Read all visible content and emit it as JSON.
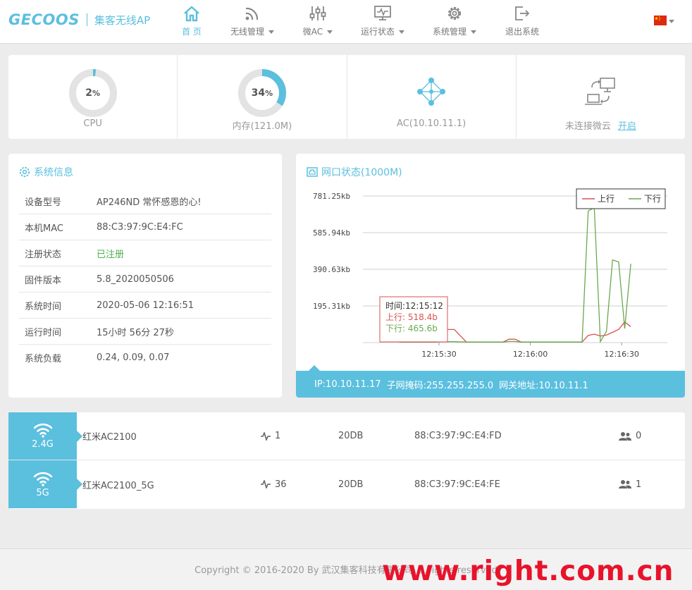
{
  "brand": {
    "logo": "GECOOS",
    "subtitle": "集客无线AP"
  },
  "nav": [
    {
      "label": "首 页",
      "icon": "home-icon",
      "active": true
    },
    {
      "label": "无线管理",
      "icon": "wifi-signal-icon",
      "dropdown": true
    },
    {
      "label": "微AC",
      "icon": "sliders-icon",
      "dropdown": true
    },
    {
      "label": "运行状态",
      "icon": "monitor-icon",
      "dropdown": true
    },
    {
      "label": "系统管理",
      "icon": "gear-icon",
      "dropdown": true
    },
    {
      "label": "退出系统",
      "icon": "logout-icon"
    }
  ],
  "language_flag": "china-flag-icon",
  "stats": {
    "cpu": {
      "value": "2",
      "unit": "%",
      "label": "CPU",
      "fraction": 0.02
    },
    "memory": {
      "value": "34",
      "unit": "%",
      "label": "内存(121.0M)",
      "fraction": 0.34
    },
    "ac": {
      "label": "AC(10.10.11.1)",
      "icon": "network-topology-icon"
    },
    "cloud": {
      "label": "未连接微云",
      "link": "开启",
      "icon": "remote-connection-icon"
    }
  },
  "system_info": {
    "title": "系统信息",
    "rows": [
      {
        "key": "设备型号",
        "value": "AP246ND 常怀感恩的心!"
      },
      {
        "key": "本机MAC",
        "value": "88:C3:97:9C:E4:FC"
      },
      {
        "key": "注册状态",
        "value": "已注册",
        "status": "success"
      },
      {
        "key": "固件版本",
        "value": "5.8_2020050506"
      },
      {
        "key": "系统时间",
        "value": "2020-05-06 12:16:51"
      },
      {
        "key": "运行时间",
        "value": "15小时 56分 27秒"
      },
      {
        "key": "系统负载",
        "value": "0.24, 0.09, 0.07"
      }
    ]
  },
  "network": {
    "title": "网口状态(1000M)",
    "ip": "IP:10.10.11.17",
    "mask": "子网掩码:255.255.255.0",
    "gateway": "网关地址:10.10.11.1"
  },
  "chart_data": {
    "type": "line",
    "title": "",
    "x_ticks": [
      "12:15:30",
      "12:16:00",
      "12:16:30"
    ],
    "y_ticks": [
      "195.31kb",
      "390.63kb",
      "585.94kb",
      "781.25kb"
    ],
    "ylim": [
      0,
      781.25
    ],
    "y_unit": "kb",
    "grid": true,
    "legend_position": "top-right",
    "series": [
      {
        "name": "上行",
        "color": "#d9534f",
        "x": [
          12,
          18,
          24,
          26,
          28,
          30,
          34,
          38,
          42,
          46,
          48,
          50,
          52,
          54,
          56,
          58,
          60,
          62,
          64,
          66,
          68,
          70,
          72,
          74,
          76,
          78,
          80,
          82,
          84,
          86,
          88
        ],
        "y": [
          3,
          3,
          3,
          70,
          70,
          70,
          3,
          3,
          3,
          3,
          18,
          18,
          3,
          3,
          3,
          3,
          3,
          3,
          3,
          3,
          3,
          3,
          3,
          38,
          45,
          35,
          40,
          55,
          70,
          110,
          85
        ]
      },
      {
        "name": "下行",
        "color": "#6aa84f",
        "x": [
          12,
          18,
          24,
          26,
          28,
          30,
          34,
          38,
          42,
          46,
          48,
          50,
          52,
          54,
          56,
          58,
          60,
          62,
          64,
          66,
          68,
          70,
          72,
          74,
          76,
          78,
          80,
          82,
          84,
          86,
          88
        ],
        "y": [
          3,
          3,
          3,
          5,
          5,
          5,
          3,
          3,
          3,
          3,
          6,
          6,
          3,
          3,
          3,
          3,
          3,
          3,
          3,
          3,
          3,
          3,
          3,
          700,
          720,
          5,
          60,
          440,
          430,
          75,
          420
        ]
      }
    ],
    "tooltip": {
      "time": "时间:12:15:12",
      "up": "上行: 518.4b",
      "down": "下行: 465.6b"
    }
  },
  "radios": [
    {
      "band": "2.4G",
      "ssid": "红米AC2100",
      "channel": "1",
      "power": "20DB",
      "mac": "88:C3:97:9C:E4:FD",
      "clients": "0"
    },
    {
      "band": "5G",
      "ssid": "红米AC2100_5G",
      "channel": "36",
      "power": "20DB",
      "mac": "88:C3:97:9C:E4:FE",
      "clients": "1"
    }
  ],
  "footer": {
    "copyright": "Copyright © 2016-2020 By 武汉集客科技有限公司 ... rights reserved"
  },
  "watermark": "www.right.com.cn"
}
